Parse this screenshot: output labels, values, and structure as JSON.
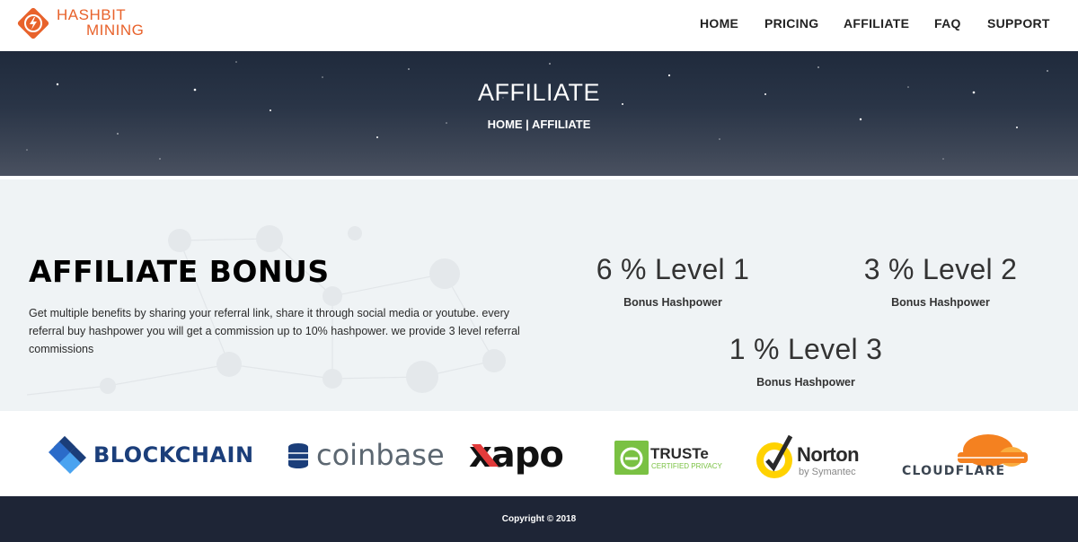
{
  "brand": {
    "line1": "HASHBIT",
    "line2": "MINING",
    "color": "#e8622b"
  },
  "nav": {
    "items": [
      {
        "label": "HOME"
      },
      {
        "label": "PRICING"
      },
      {
        "label": "AFFILIATE"
      },
      {
        "label": "FAQ"
      },
      {
        "label": "SUPPORT"
      }
    ]
  },
  "hero": {
    "title": "AFFILIATE",
    "breadcrumb": {
      "home": "HOME",
      "separator": " | ",
      "current": "AFFILIATE"
    }
  },
  "affiliate": {
    "title": "AFFILIATE BONUS",
    "description": "Get multiple benefits by sharing your referral link, share it through social media or youtube. every referral buy hashpower you will get a commission up to 10% hashpower. we provide 3 level referral commissions",
    "levels": [
      {
        "value": "6 % Level 1",
        "label": "Bonus Hashpower"
      },
      {
        "value": "3 % Level 2",
        "label": "Bonus Hashpower"
      },
      {
        "value": "1 % Level 3",
        "label": "Bonus Hashpower"
      }
    ]
  },
  "partners": {
    "blockchain": "BLOCKCHAIN",
    "coinbase": "coinbase",
    "xapo": "xapo",
    "truste_name": "TRUSTe",
    "truste_sub": "CERTIFIED PRIVACY",
    "norton_name": "Norton",
    "norton_sub": "by Symantec",
    "cloudflare": "CLOUDFLARE"
  },
  "footer": {
    "copyright": "Copyright © 2018"
  }
}
